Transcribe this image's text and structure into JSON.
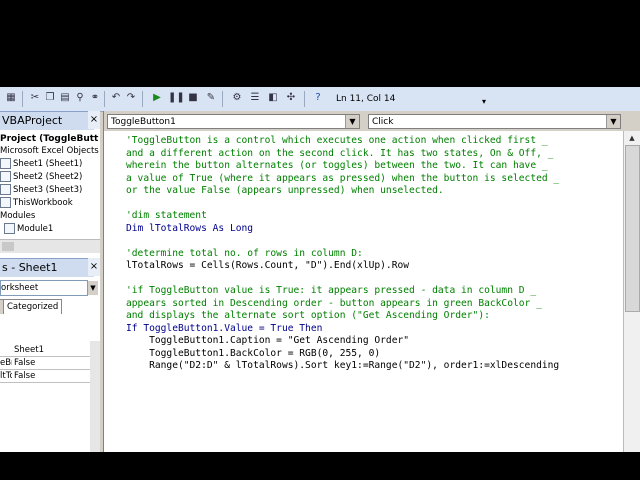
{
  "toolbar": {
    "status": "Ln 11, Col 14",
    "icons": [
      "view-excel-icon",
      "insert-icon",
      "cut-icon",
      "copy-icon",
      "paste-icon",
      "find-icon",
      "undo-icon",
      "redo-icon",
      "run-icon",
      "break-icon",
      "reset-icon",
      "design-mode-icon",
      "project-explorer-icon",
      "properties-icon",
      "object-browser-icon",
      "toolbox-icon",
      "help-icon"
    ]
  },
  "project": {
    "title": "VBAProject",
    "root": "Project (ToggleButt",
    "folder": "Microsoft Excel Objects",
    "items": [
      "Sheet1 (Sheet1)",
      "Sheet2 (Sheet2)",
      "Sheet3 (Sheet3)",
      "ThisWorkbook"
    ],
    "modules_folder": "Modules",
    "module": "Module1"
  },
  "properties": {
    "title": "s - Sheet1",
    "object": "orksheet",
    "tab_alpha": "",
    "tab_categorized": "Categorized",
    "rows": [
      {
        "name": "",
        "value": "Sheet1"
      },
      {
        "name": "eBre",
        "value": "False"
      },
      {
        "name": "ltTo",
        "value": "False"
      }
    ]
  },
  "code_window": {
    "object": "ToggleButton1",
    "procedure": "Click",
    "lines": [
      {
        "t": "'ToggleButton is a control which executes one action when clicked first _",
        "c": "cm"
      },
      {
        "t": "and a different action on the second click. It has two states, On & Off, _",
        "c": "cm"
      },
      {
        "t": "wherein the button alternates (or toggles) between the two. It can have _",
        "c": "cm"
      },
      {
        "t": "a value of True (where it appears as pressed) when the button is selected _",
        "c": "cm"
      },
      {
        "t": "or the value False (appears unpressed) when unselected.",
        "c": "cm"
      },
      {
        "t": "",
        "c": ""
      },
      {
        "t": "'dim statement",
        "c": "cm"
      },
      {
        "t": "Dim lTotalRows As Long",
        "c": "kw"
      },
      {
        "t": "",
        "c": ""
      },
      {
        "t": "'determine total no. of rows in column D:",
        "c": "cm"
      },
      {
        "t": "lTotalRows = Cells(Rows.Count, \"D\").End(xlUp).Row",
        "c": ""
      },
      {
        "t": "",
        "c": ""
      },
      {
        "t": "'if ToggleButton value is True: it appears pressed - data in column D _",
        "c": "cm"
      },
      {
        "t": "appears sorted in Descending order - button appears in green BackColor _",
        "c": "cm"
      },
      {
        "t": "and displays the alternate sort option (\"Get Ascending Order\"):",
        "c": "cm"
      },
      {
        "t": "If ToggleButton1.Value = True Then",
        "c": "kw"
      },
      {
        "t": "    ToggleButton1.Caption = \"Get Ascending Order\"",
        "c": ""
      },
      {
        "t": "    ToggleButton1.BackColor = RGB(0, 255, 0)",
        "c": ""
      },
      {
        "t": "    Range(\"D2:D\" & lTotalRows).Sort key1:=Range(\"D2\"), order1:=xlDescending",
        "c": ""
      }
    ]
  },
  "colors": {
    "comment": "#008000",
    "keyword": "#00008b",
    "toolbar_bg": "#d8e4f4"
  }
}
